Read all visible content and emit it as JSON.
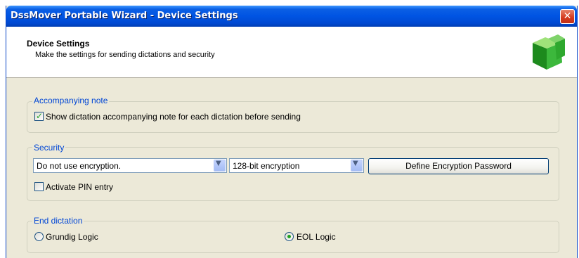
{
  "window": {
    "title": "DssMover Portable Wizard - Device Settings",
    "close_symbol": "✕"
  },
  "header": {
    "title": "Device Settings",
    "subtitle": "Make the settings for sending dictations and security",
    "icon": "green-cube-icon"
  },
  "accompanying_note": {
    "group_label": "Accompanying note",
    "checkbox_label": "Show dictation accompanying note for each dictation before sending",
    "checked": true
  },
  "security": {
    "group_label": "Security",
    "encryption_select": "Do not use encryption.",
    "bits_select": "128-bit encryption",
    "define_password_button": "Define Encryption Password",
    "pin_label": "Activate PIN entry",
    "pin_checked": false
  },
  "end_dictation": {
    "group_label": "End dictation",
    "option1": "Grundig Logic",
    "option2": "EOL Logic",
    "selected": "EOL Logic"
  },
  "colors": {
    "title_blue": "#0054e3",
    "group_label": "#0046d5",
    "dialog_bg": "#ece9d8",
    "check_green": "#21a121"
  }
}
